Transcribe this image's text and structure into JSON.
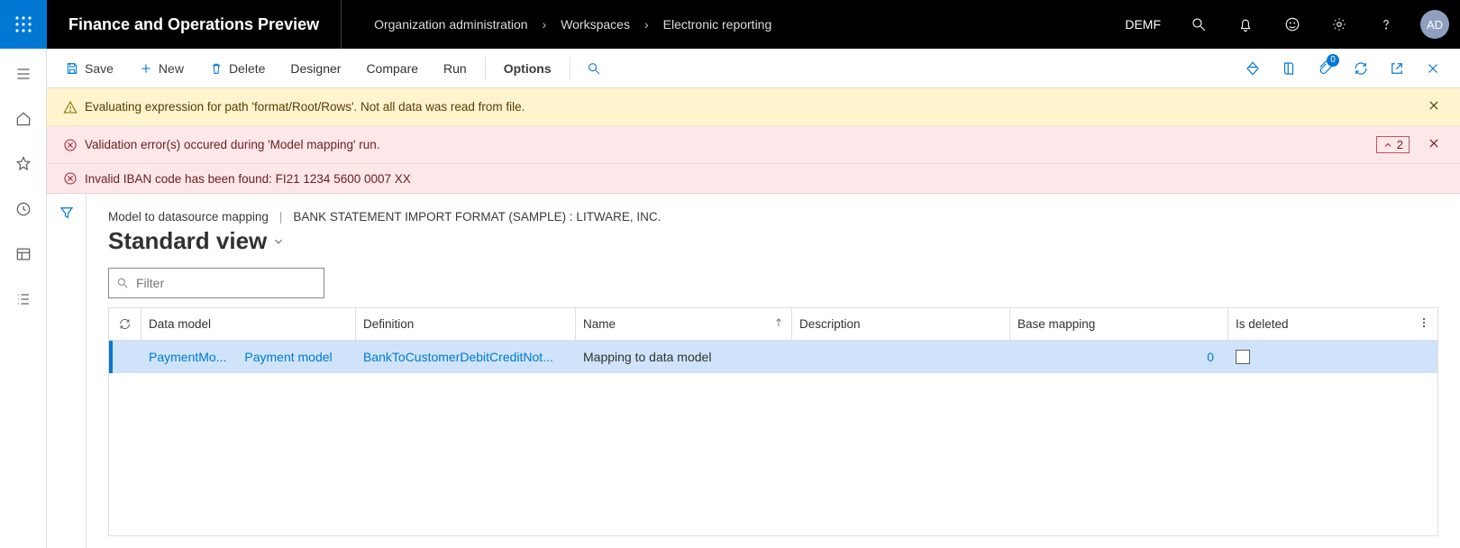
{
  "header": {
    "appTitle": "Finance and Operations Preview",
    "breadcrumbs": [
      "Organization administration",
      "Workspaces",
      "Electronic reporting"
    ],
    "legalEntity": "DEMF",
    "avatar": "AD"
  },
  "commandBar": {
    "save": "Save",
    "new": "New",
    "delete": "Delete",
    "designer": "Designer",
    "compare": "Compare",
    "run": "Run",
    "options": "Options",
    "attachBadge": "0"
  },
  "messages": {
    "warning": "Evaluating expression for path 'format/Root/Rows'.   Not all data was read from file.",
    "errorMain": "Validation error(s) occured during 'Model mapping' run.",
    "errorCount": "2",
    "errorDetail": "Invalid IBAN code has been found: FI21 1234 5600 0007 XX"
  },
  "page": {
    "title1": "Model to datasource mapping",
    "title2": "BANK STATEMENT IMPORT FORMAT (SAMPLE) : LITWARE, INC.",
    "viewName": "Standard view",
    "filterPlaceholder": "Filter"
  },
  "grid": {
    "columns": {
      "dataModel": "Data model",
      "definition": "Definition",
      "name": "Name",
      "description": "Description",
      "baseMapping": "Base mapping",
      "isDeleted": "Is deleted"
    },
    "row": {
      "dataModelShort": "PaymentMo...",
      "dataModelFull": "Payment model",
      "definition": "BankToCustomerDebitCreditNot...",
      "name": "Mapping to data model",
      "description": "",
      "baseMapping": "0",
      "isDeleted": false
    }
  }
}
